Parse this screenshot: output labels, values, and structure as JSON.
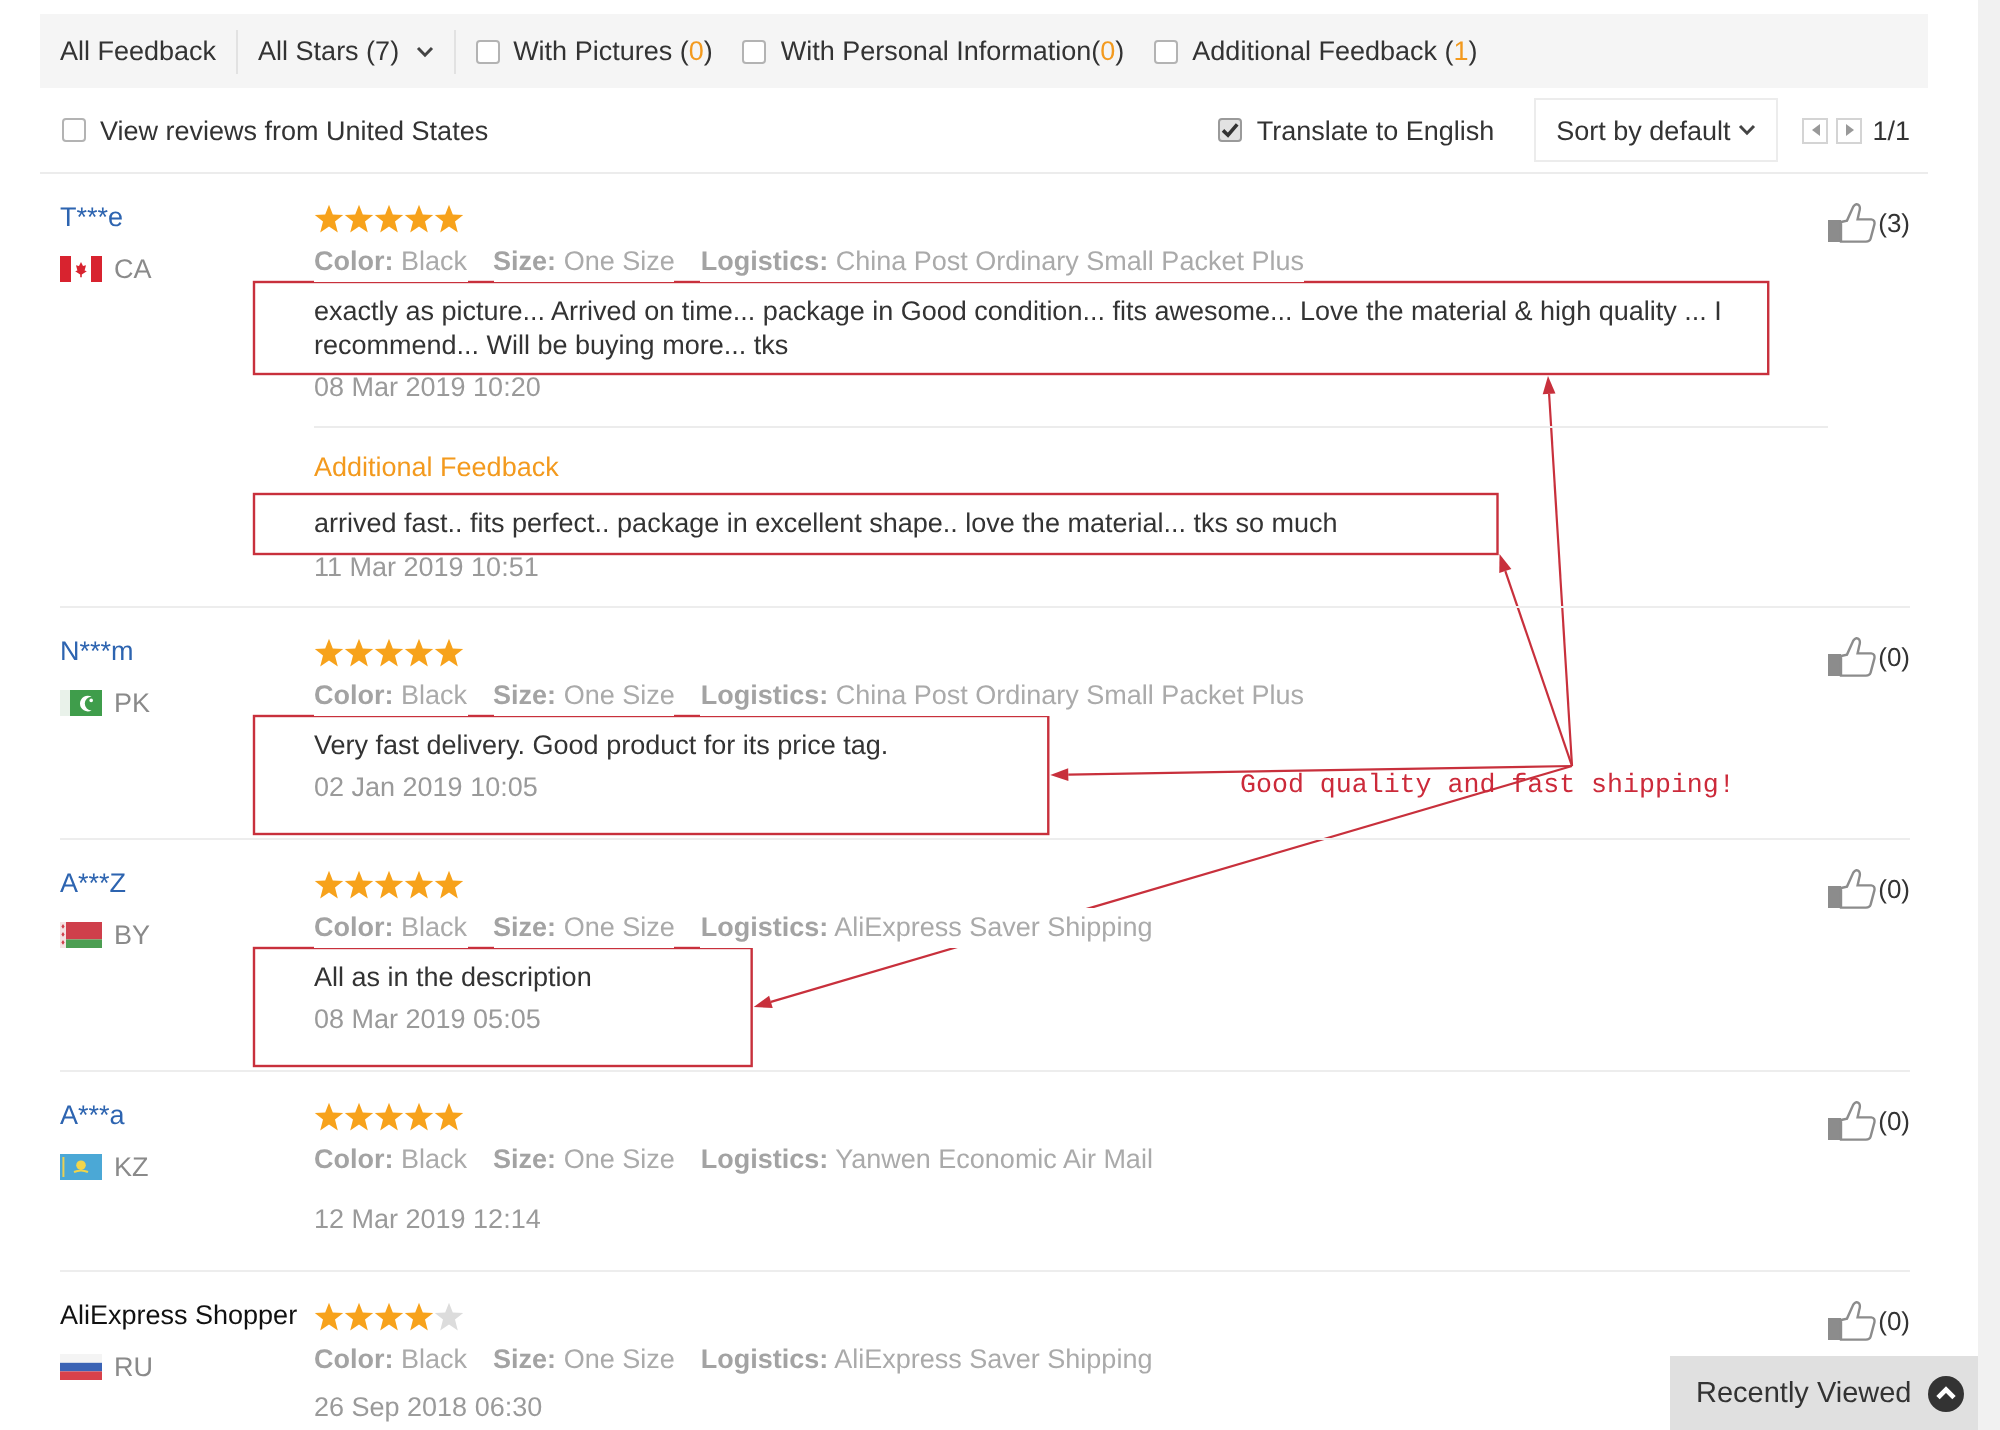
{
  "filter_bar": {
    "items": [
      {
        "kind": "link",
        "label": "All Feedback"
      },
      {
        "kind": "dropdown",
        "label": "All Stars (7)"
      },
      {
        "kind": "checkbox",
        "label": "With Pictures (",
        "count": "0",
        "label_end": ")",
        "checked": false
      },
      {
        "kind": "checkbox",
        "label": "With Personal Information(",
        "count": "0",
        "label_end": ")",
        "checked": false
      },
      {
        "kind": "checkbox",
        "label": "Additional Feedback (",
        "count": "1",
        "label_end": ")",
        "checked": false
      }
    ]
  },
  "options_bar": {
    "region_filter": {
      "label": "View reviews from United States",
      "checked": false
    },
    "translate": {
      "label": "Translate to English",
      "checked": true
    },
    "sort": {
      "label": "Sort by default"
    },
    "pagination": {
      "page": "1/1"
    }
  },
  "reviews": [
    {
      "user": "T***e",
      "linked": true,
      "flag": {
        "kind": "canada"
      },
      "country": "CA",
      "stars": 5,
      "attributes": [
        {
          "label": "Color:",
          "value": "Black"
        },
        {
          "label": "Size:",
          "value": "One Size"
        },
        {
          "label": "Logistics:",
          "value": "China Post Ordinary Small Packet Plus"
        }
      ],
      "text": "exactly as picture... Arrived on time... package in Good condition... fits awesome... Love the material & high quality ... I recommend... Will be buying more... tks",
      "date": "08 Mar 2019 10:20",
      "highlighted": true,
      "helpful": "(3)",
      "additional_feedback": {
        "heading": "Additional Feedback",
        "text": "arrived fast.. fits perfect.. package in excellent shape.. love the material... tks so much",
        "date": "11 Mar 2019 10:51",
        "highlighted": true
      }
    },
    {
      "user": "N***m",
      "linked": true,
      "flag": {
        "kind": "pakistan"
      },
      "country": "PK",
      "stars": 5,
      "attributes": [
        {
          "label": "Color:",
          "value": "Black"
        },
        {
          "label": "Size:",
          "value": "One Size"
        },
        {
          "label": "Logistics:",
          "value": "China Post Ordinary Small Packet Plus"
        }
      ],
      "text": "Very fast delivery. Good product for its price tag.",
      "date": "02 Jan 2019 10:05",
      "highlighted": true,
      "helpful": "(0)"
    },
    {
      "user": "A***Z",
      "linked": true,
      "flag": {
        "kind": "belarus"
      },
      "country": "BY",
      "stars": 5,
      "attributes": [
        {
          "label": "Color:",
          "value": "Black"
        },
        {
          "label": "Size:",
          "value": "One Size"
        },
        {
          "label": "Logistics:",
          "value": "AliExpress Saver Shipping"
        }
      ],
      "text": "All as in the description",
      "date": "08 Mar 2019 05:05",
      "highlighted": true,
      "helpful": "(0)"
    },
    {
      "user": "A***a",
      "linked": true,
      "flag": {
        "kind": "kazakhstan"
      },
      "country": "KZ",
      "stars": 5,
      "attributes": [
        {
          "label": "Color:",
          "value": "Black"
        },
        {
          "label": "Size:",
          "value": "One Size"
        },
        {
          "label": "Logistics:",
          "value": "Yanwen Economic Air Mail"
        }
      ],
      "date": "12 Mar 2019 12:14",
      "highlighted": false,
      "helpful": "(0)"
    },
    {
      "user": "AliExpress Shopper",
      "linked": false,
      "flag": {
        "kind": "russia"
      },
      "country": "RU",
      "stars": 4,
      "attributes": [
        {
          "label": "Color:",
          "value": "Black"
        },
        {
          "label": "Size:",
          "value": "One Size"
        },
        {
          "label": "Logistics:",
          "value": "AliExpress Saver Shipping"
        }
      ],
      "date": "26 Sep 2018 06:30",
      "highlighted": false,
      "helpful": "(0)"
    }
  ],
  "annotation": {
    "text": "Good quality and fast shipping!"
  },
  "recently_viewed": {
    "label": "Recently Viewed"
  }
}
